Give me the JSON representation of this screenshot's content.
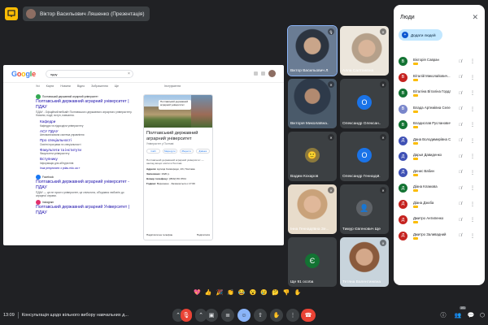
{
  "presenter": {
    "label": "Віктор Васильович Ляшенко (Презентація)"
  },
  "google": {
    "query": "пдау",
    "tabs": [
      "Усі",
      "Карти",
      "Новини",
      "Відео",
      "Зображення",
      "Ще"
    ],
    "tools": "Інструменти",
    "results": [
      {
        "source": "Полтавський державний аграрний університет",
        "title": "Полтавський державний аграрний університет | ПДАУ",
        "snippet": "ПДАУ - Офіційний вебсайт Полтавського державного аграрного університету. Новини, події, вступ, навчання."
      },
      {
        "source": "Facebook",
        "title": "Полтавський державний аграрний університет - ПДАУ",
        "snippet": "ПДАУ — це не просто університет, це спільнота, об'єднана любов'ю до аграрної справи."
      },
      {
        "source": "Instagram",
        "title": "Полтавський державний аграрний Університет | ПДАУ",
        "snippet": ""
      }
    ],
    "sitelinks": [
      {
        "title": "Кафедри",
        "desc": "Кафедри та підрозділи університету"
      },
      {
        "title": "АСУ ПДАУ",
        "desc": "Автоматизована система управління"
      },
      {
        "title": "Про спеціальності",
        "desc": "Освітні програми та спеціальності"
      },
      {
        "title": "Факультети та інститути",
        "desc": "Факультети університету"
      },
      {
        "title": "Вступнику",
        "desc": "Інформація для абітурієнтів"
      }
    ],
    "more_link": "Інші результати з pdau.edu.ua »",
    "kp": {
      "map_label": "Полтавський державний аграрний університет",
      "title": "Полтавський державний аграрний університет",
      "subtitle": "Університет у Полтаві",
      "buttons": [
        "Сайт",
        "Маршрути",
        "Зберегти",
        "Дзвінок"
      ],
      "desc": "Полтавський державний аграрний університет — заклад вищої освіти в Полтаві.",
      "rows": [
        {
          "k": "Адреса:",
          "v": "вулиця Сковороди, 1/3, Полтава"
        },
        {
          "k": "Засновано:",
          "v": "1920 р."
        },
        {
          "k": "Номер телефону:",
          "v": "(0532) 56 0704"
        },
        {
          "k": "Години:",
          "v": "Відчинено · Зачиняється о 17:00"
        }
      ],
      "footer_left": "Надіслати на телефон",
      "footer_right": "Поділитися"
    }
  },
  "tiles": [
    {
      "name": "Віктор Васильович Л...",
      "color": "#5a4a3c",
      "type": "video"
    },
    {
      "name": "Алла Салтанівна",
      "color": "#8a7e70",
      "type": "video"
    },
    {
      "name": "Вікторія Миколаївна...",
      "color": "#6b5a48",
      "type": "video"
    },
    {
      "name": "Олександр Олексан...",
      "color": "#3c4043",
      "letter": "О",
      "circle": "#1a73e8"
    },
    {
      "name": "Вадим Кохаров",
      "color": "#3c4043",
      "type": "avatar"
    },
    {
      "name": "Олександр Геннадій...",
      "color": "#3c4043",
      "letter": "О",
      "circle": "#1a73e8"
    },
    {
      "name": "Інна Геннадіївна Зе...",
      "color": "#4a4038",
      "type": "video"
    },
    {
      "name": "Тимур Євгенович Ще...",
      "color": "#3c4043",
      "type": "avatar2"
    },
    {
      "name": "Ще 91 особа",
      "color": "#3c4043",
      "letter": "Є",
      "circle": "#137333"
    },
    {
      "name": "Тетяна Валентинівна...",
      "color": "#5c5046",
      "type": "video"
    }
  ],
  "people": {
    "title": "Люди",
    "add_label": "Додати людей",
    "list": [
      {
        "name": "Вікторія Савран",
        "letter": "В",
        "color": "#137333"
      },
      {
        "name": "Віталій Миколайович...",
        "letter": "В",
        "color": "#c5221f"
      },
      {
        "name": "Віталіна Віталіна Горда",
        "letter": "В",
        "color": "#137333"
      },
      {
        "name": "Влада Артемівна Селе...",
        "letter": "В",
        "color": "#7986cb"
      },
      {
        "name": "Владислав Русланович...",
        "letter": "В",
        "color": "#137333"
      },
      {
        "name": "Дана Володимирівна С...",
        "letter": "Д",
        "color": "#3f51b5"
      },
      {
        "name": "Дарья Давиденко",
        "letter": "Д",
        "color": "#3f51b5"
      },
      {
        "name": "Денис Вабин",
        "letter": "Д",
        "color": "#3f51b5"
      },
      {
        "name": "Діана Кламова",
        "letter": "Д",
        "color": "#137333"
      },
      {
        "name": "Діана Дзюба",
        "letter": "Д",
        "color": "#c5221f"
      },
      {
        "name": "Дмитро Антипенко",
        "letter": "Д",
        "color": "#c5221f"
      },
      {
        "name": "Дмитро Заливадний",
        "letter": "Д",
        "color": "#c5221f"
      }
    ]
  },
  "emojis": [
    "💖",
    "👍",
    "🎉",
    "👏",
    "😂",
    "😮",
    "😢",
    "🤔",
    "👎",
    "✋"
  ],
  "bottom": {
    "time": "13:09",
    "title": "Консультація щодо вільного вибору навчальних д...",
    "people_count": "101"
  },
  "colors": {
    "accent": "#8ab4f8",
    "end_call": "#ea4335",
    "mic_off": "#ea4335"
  }
}
